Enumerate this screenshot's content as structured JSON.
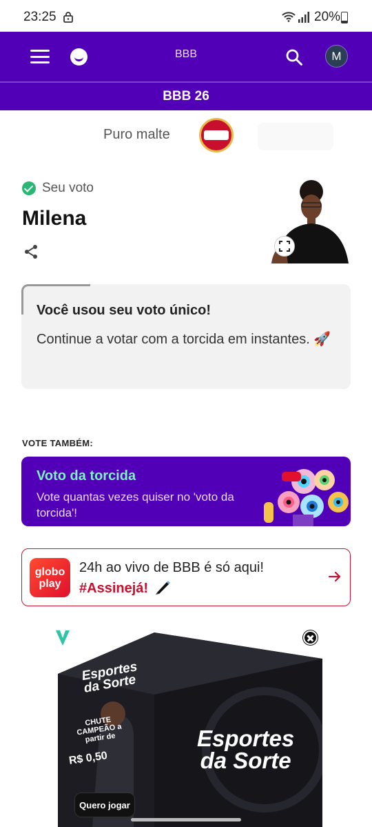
{
  "status_bar": {
    "time": "23:25",
    "battery": "20%"
  },
  "header": {
    "brand": "BBB",
    "avatar_initial": "M"
  },
  "subheader": {
    "title": "BBB 26"
  },
  "sponsor": {
    "label": "Puro malte",
    "logo_name": "amstel-lager-logo"
  },
  "vote": {
    "status": "Seu voto",
    "participant": "Milena"
  },
  "info": {
    "title": "Você usou seu voto único!",
    "body": "Continue a votar com a torcida em instantes. 🚀"
  },
  "also": {
    "heading": "VOTE TAMBÉM:"
  },
  "torcida": {
    "title": "Voto da torcida",
    "subtitle": "Vote quantas vezes quiser no 'voto da torcida'!"
  },
  "globoplay": {
    "logo_line1": "globo",
    "logo_line2": "play",
    "line1": "24h ao vivo de BBB é só aqui!",
    "line2": "#Assinejá!"
  },
  "ad": {
    "brand_line1": "Esportes",
    "brand_line2": "da Sorte",
    "promo": "CHUTE CAMPEÃO a partir de",
    "price": "R$ 0,50",
    "cta": "Quero jogar",
    "big_line1": "Esportes",
    "big_line2": "da Sorte"
  },
  "colors": {
    "primary": "#5200b8",
    "accent_green": "#7ff0c8",
    "globo_red": "#c8102e"
  }
}
